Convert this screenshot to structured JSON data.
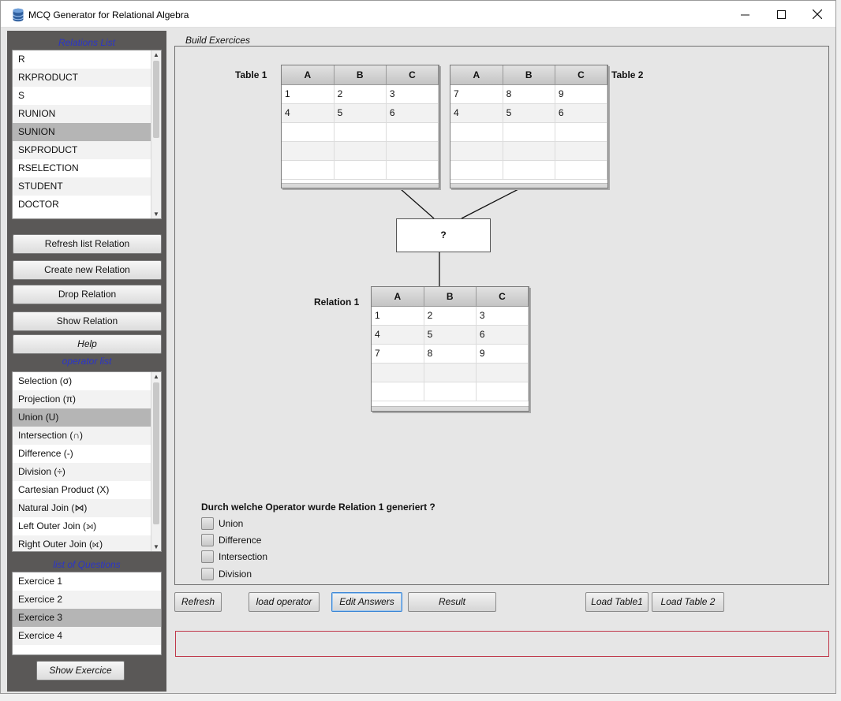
{
  "window": {
    "title": "MCQ Generator for Relational Algebra",
    "controls": {
      "minimize": "—",
      "maximize": "☐",
      "close": "✕"
    }
  },
  "sidebar": {
    "relations_title": "Relations List",
    "relations": [
      "R",
      "RKPRODUCT",
      "S",
      "RUNION",
      "SUNION",
      "SKPRODUCT",
      "RSELECTION",
      "STUDENT",
      "DOCTOR"
    ],
    "selected_relation": "SUNION",
    "buttons": {
      "refresh": "Refresh list Relation",
      "create": "Create new Relation",
      "drop": "Drop Relation",
      "show": "Show Relation",
      "help": "Help"
    },
    "operators_title": "operator list",
    "operators": [
      "Selection (σ)",
      "Projection (π)",
      "Union (U)",
      "Intersection (∩)",
      "Difference (-)",
      "Division (÷)",
      "Cartesian Product (X)",
      "Natural Join (⋈)",
      "Left Outer Join (⟕)",
      "Right Outer Join (⟖)"
    ],
    "selected_operator": "Union (U)",
    "questions_title": "list of Questions",
    "questions": [
      "Exercice 1",
      "Exercice 2",
      "Exercice 3",
      "Exercice 4"
    ],
    "selected_question": "Exercice 3",
    "show_exercice": "Show Exercice"
  },
  "main": {
    "build_label": "Build Exercices",
    "table1": {
      "label": "Table 1",
      "columns": [
        "A",
        "B",
        "C"
      ],
      "rows": [
        [
          "1",
          "2",
          "3"
        ],
        [
          "4",
          "5",
          "6"
        ],
        [
          "",
          "",
          ""
        ],
        [
          "",
          "",
          ""
        ],
        [
          "",
          "",
          ""
        ]
      ]
    },
    "table2": {
      "label": "Table 2",
      "columns": [
        "A",
        "B",
        "C"
      ],
      "rows": [
        [
          "7",
          "8",
          "9"
        ],
        [
          "4",
          "5",
          "6"
        ],
        [
          "",
          "",
          ""
        ],
        [
          "",
          "",
          ""
        ],
        [
          "",
          "",
          ""
        ]
      ]
    },
    "operator_placeholder": "?",
    "relation1": {
      "label": "Relation 1",
      "columns": [
        "A",
        "B",
        "C"
      ],
      "rows": [
        [
          "1",
          "2",
          "3"
        ],
        [
          "4",
          "5",
          "6"
        ],
        [
          "7",
          "8",
          "9"
        ],
        [
          "",
          "",
          ""
        ],
        [
          "",
          "",
          ""
        ]
      ]
    },
    "question": "Durch welche Operator wurde Relation 1 generiert  ?",
    "options": [
      "Union",
      "Difference",
      "Intersection",
      "Division"
    ],
    "buttons": {
      "refresh": "Refresh",
      "load_operator": "load operator",
      "edit_answers": "Edit Answers",
      "result": "Result",
      "load_table1": "Load Table1",
      "load_table2": "Load Table 2"
    }
  },
  "colors": {
    "sidebar_bg": "#5a5857",
    "section_title": "#2b35c8",
    "selected_row": "#b5b5b5",
    "status_border": "#c0394b"
  }
}
